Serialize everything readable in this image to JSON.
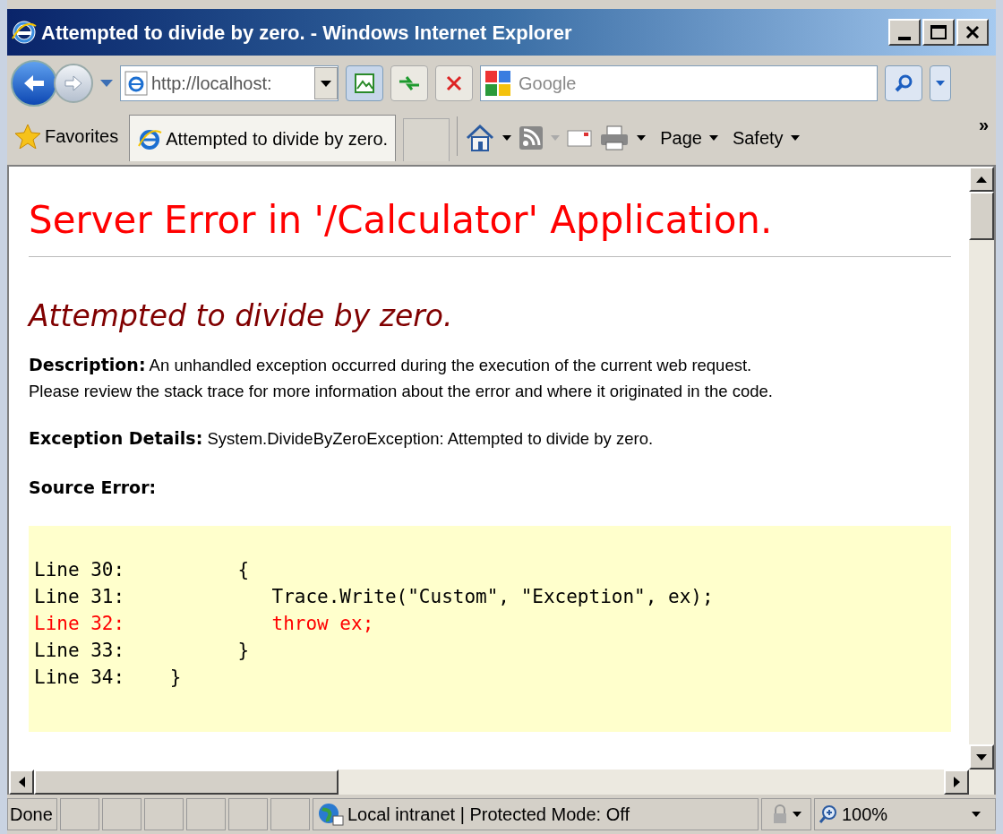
{
  "window": {
    "title": "Attempted to divide by zero. - Windows Internet Explorer"
  },
  "address_bar": {
    "url": "http://localhost:"
  },
  "search": {
    "placeholder": "Google"
  },
  "favorites": {
    "label": "Favorites"
  },
  "tabs": [
    {
      "label": "Attempted to divide by zero.",
      "selected": true
    }
  ],
  "command_bar": [
    {
      "label": "Page"
    },
    {
      "label": "Safety"
    }
  ],
  "more": "»",
  "page": {
    "heading": "Server Error in '/Calculator' Application.",
    "error_title": "Attempted to divide by zero.",
    "description": {
      "label": "Description:",
      "text": "An unhandled exception occurred during the execution of the current web request.\nPlease review the stack trace for more information about the error and where it originated in the code."
    },
    "exception_details": {
      "label": "Exception Details:",
      "text": "System.DivideByZeroException: Attempted to divide by zero."
    },
    "source_error_label": "Source Error:",
    "code_lines": [
      {
        "label": "Line 30:",
        "code": "          {",
        "highlighted": false
      },
      {
        "label": "Line 31:",
        "code": "             Trace.Write(\"Custom\", \"Exception\", ex);",
        "highlighted": false
      },
      {
        "label": "Line 32:",
        "code": "             throw ex;",
        "highlighted": true
      },
      {
        "label": "Line 33:",
        "code": "          }",
        "highlighted": false
      },
      {
        "label": "Line 34:",
        "code": "    }",
        "highlighted": false
      }
    ]
  },
  "status_bar": {
    "status": "Done",
    "zone": "Local intranet | Protected Mode: Off",
    "zoom": "100%"
  }
}
